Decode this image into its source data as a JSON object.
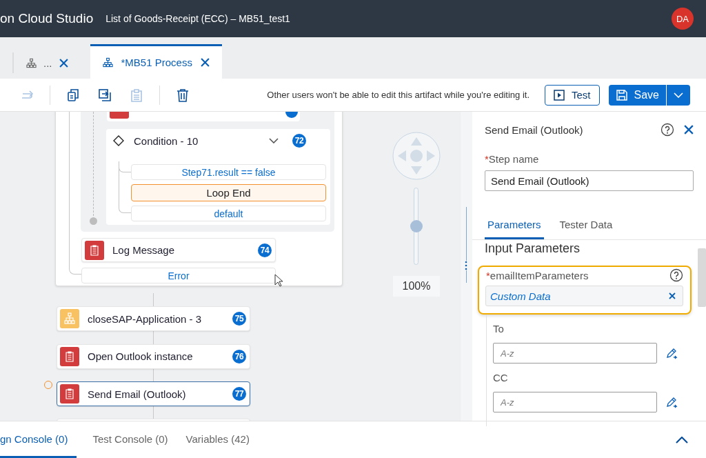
{
  "header": {
    "app_title": "on Cloud Studio",
    "document_title": "List of Goods-Receipt (ECC) – MB51_test1",
    "avatar": "DA"
  },
  "tabs": [
    {
      "label": "...",
      "selected": false
    },
    {
      "label": "*MB51 Process",
      "selected": true
    }
  ],
  "toolbar": {
    "actions": [
      {
        "kind": "redo",
        "disabled": true
      },
      {
        "kind": "copy",
        "disabled": false
      },
      {
        "kind": "import",
        "disabled": false
      },
      {
        "kind": "paste",
        "disabled": true
      },
      {
        "kind": "delete",
        "disabled": false
      }
    ],
    "message": "Other users won't be able to edit this artifact while you're editing it.",
    "test_button": "Test",
    "save_button": "Save"
  },
  "canvas": {
    "condition": {
      "title": "Condition - 10",
      "expanded": true,
      "badge": "72",
      "branches": [
        {
          "label": "Step71.result == false",
          "kind": "branch"
        },
        {
          "label": "Loop End",
          "kind": "step"
        },
        {
          "label": "default",
          "kind": "branch"
        }
      ]
    },
    "log_step": {
      "label": "Log Message",
      "badge": "74",
      "kind": "activity"
    },
    "error_branch": "Error",
    "steps": [
      {
        "label": "closeSAP-Application - 3",
        "badge": "75",
        "kind": "flow",
        "selected": false
      },
      {
        "label": "Open Outlook instance",
        "badge": "76",
        "kind": "activity",
        "selected": false
      },
      {
        "label": "Send Email (Outlook)",
        "badge": "77",
        "kind": "activity",
        "selected": true
      }
    ],
    "zoom": {
      "level": 0.5,
      "reading": "100%"
    }
  },
  "panel": {
    "title": "Send Email (Outlook)",
    "step_name_label": "Step name",
    "step_name_mark": "*",
    "step_name": "Send Email (Outlook)",
    "tabs": [
      {
        "label": "Parameters",
        "selected": true
      },
      {
        "label": "Tester Data",
        "selected": false
      }
    ],
    "section_title": "Input Parameters",
    "parameter": {
      "label": "emailItemParameters",
      "required_mark": "*",
      "value": "Custom Data"
    },
    "fields": [
      {
        "label": "To",
        "placeholder": "A-z"
      },
      {
        "label": "CC",
        "placeholder": "A-z"
      }
    ]
  },
  "console_tabs": [
    {
      "label": "gn Console (0)",
      "selected": true
    },
    {
      "label": "Test Console (0)",
      "selected": false
    },
    {
      "label": "Variables (42)",
      "selected": false
    }
  ]
}
